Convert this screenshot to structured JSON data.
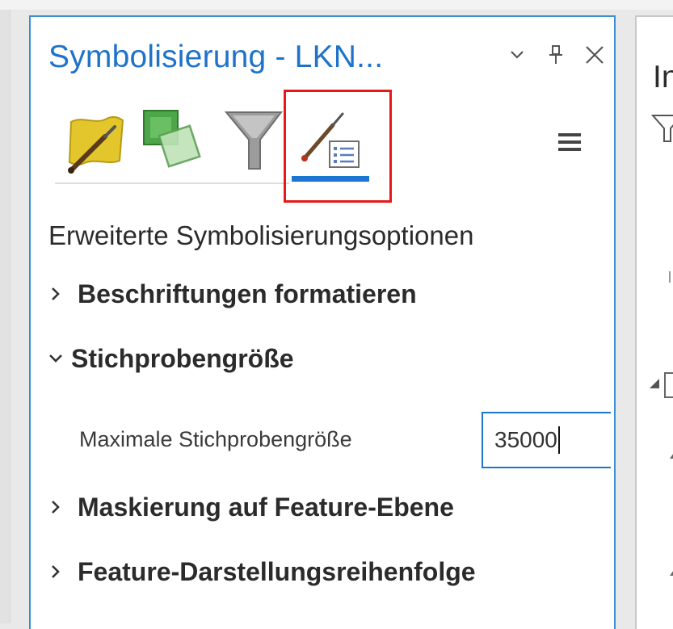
{
  "panel": {
    "title": "Symbolisierung - LKN...",
    "controls": {
      "dropdown_icon": "chevron-down-icon",
      "pin_icon": "pin-icon",
      "close_icon": "close-icon"
    },
    "tools": [
      {
        "name": "primary-symbology-tool",
        "icon": "paint-polygon-icon"
      },
      {
        "name": "vary-symbology-tool",
        "icon": "layers-paint-icon"
      },
      {
        "name": "symbol-layer-drawing-tool",
        "icon": "funnel-icon"
      },
      {
        "name": "advanced-symbology-tool",
        "icon": "brush-list-icon",
        "active": true
      }
    ],
    "section_heading": "Erweiterte Symbolisierungsoptionen",
    "sections": [
      {
        "label": "Beschriftungen formatieren",
        "expanded": false
      },
      {
        "label": "Stichprobengröße",
        "expanded": true
      },
      {
        "label": "Maskierung auf Feature-Ebene",
        "expanded": false
      },
      {
        "label": "Feature-Darstellungsreihenfolge",
        "expanded": false
      }
    ],
    "sample_size": {
      "label": "Maximale Stichprobengröße",
      "value": "35000"
    }
  },
  "second_panel": {
    "title_fragment": "In"
  },
  "colors": {
    "accent": "#1b76d1",
    "title": "#1f73c9",
    "highlight": "#e81818"
  }
}
